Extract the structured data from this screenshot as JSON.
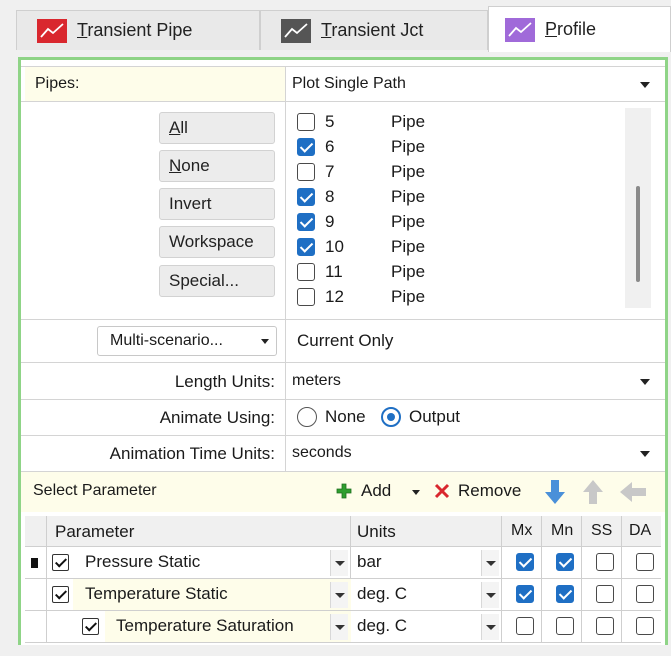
{
  "tabs": [
    {
      "label": "Transient Pipe",
      "mnemonic": "T",
      "rest": "ransient Pipe",
      "icon_color": "#d9272e"
    },
    {
      "label": "Transient Jct",
      "mnemonic": "T",
      "rest": "ransient Jct",
      "icon_color": "#555555"
    },
    {
      "label": "Profile",
      "mnemonic": "P",
      "rest": "rofile",
      "icon_color": "#a06ad9",
      "active": true
    }
  ],
  "pipes": {
    "label": "Pipes:",
    "plot_mode": "Plot Single Path",
    "buttons": [
      {
        "mnemonic": "A",
        "rest": "ll"
      },
      {
        "mnemonic": "N",
        "rest": "one"
      },
      {
        "mnemonic": "",
        "rest": "Invert"
      },
      {
        "mnemonic": "",
        "rest": "Workspace"
      },
      {
        "mnemonic": "",
        "rest": "Special..."
      }
    ],
    "list": [
      {
        "num": "5",
        "type": "Pipe",
        "checked": false
      },
      {
        "num": "6",
        "type": "Pipe",
        "checked": true
      },
      {
        "num": "7",
        "type": "Pipe",
        "checked": false
      },
      {
        "num": "8",
        "type": "Pipe",
        "checked": true
      },
      {
        "num": "9",
        "type": "Pipe",
        "checked": true
      },
      {
        "num": "10",
        "type": "Pipe",
        "checked": true
      },
      {
        "num": "11",
        "type": "Pipe",
        "checked": false
      },
      {
        "num": "12",
        "type": "Pipe",
        "checked": false
      }
    ]
  },
  "scenario": {
    "button": "Multi-scenario...",
    "value": "Current Only"
  },
  "length_units": {
    "label": "Length Units:",
    "value": "meters"
  },
  "animate": {
    "label": "Animate Using:",
    "options": [
      "None",
      "Output"
    ],
    "selected": "Output"
  },
  "time_units": {
    "label": "Animation Time Units:",
    "value": "seconds"
  },
  "parameters": {
    "title": "Select Parameter",
    "add_label": "Add",
    "remove_label": "Remove",
    "columns": [
      "Parameter",
      "Units",
      "Mx",
      "Mn",
      "SS",
      "DA"
    ],
    "rows": [
      {
        "name": "Pressure Static",
        "units": "bar",
        "mx": true,
        "mn": true,
        "ss": false,
        "da": false
      },
      {
        "name": "Temperature Static",
        "units": "deg. C",
        "mx": true,
        "mn": true,
        "ss": false,
        "da": false
      },
      {
        "name": "Temperature Saturation",
        "units": "deg. C",
        "mx": false,
        "mn": false,
        "ss": false,
        "da": false
      }
    ]
  },
  "colors": {
    "accent": "#1f6fc4",
    "panel_border": "#8fd487",
    "highlight": "#fefdea",
    "add_green": "#2f9e2f",
    "remove_red": "#d9272e"
  }
}
